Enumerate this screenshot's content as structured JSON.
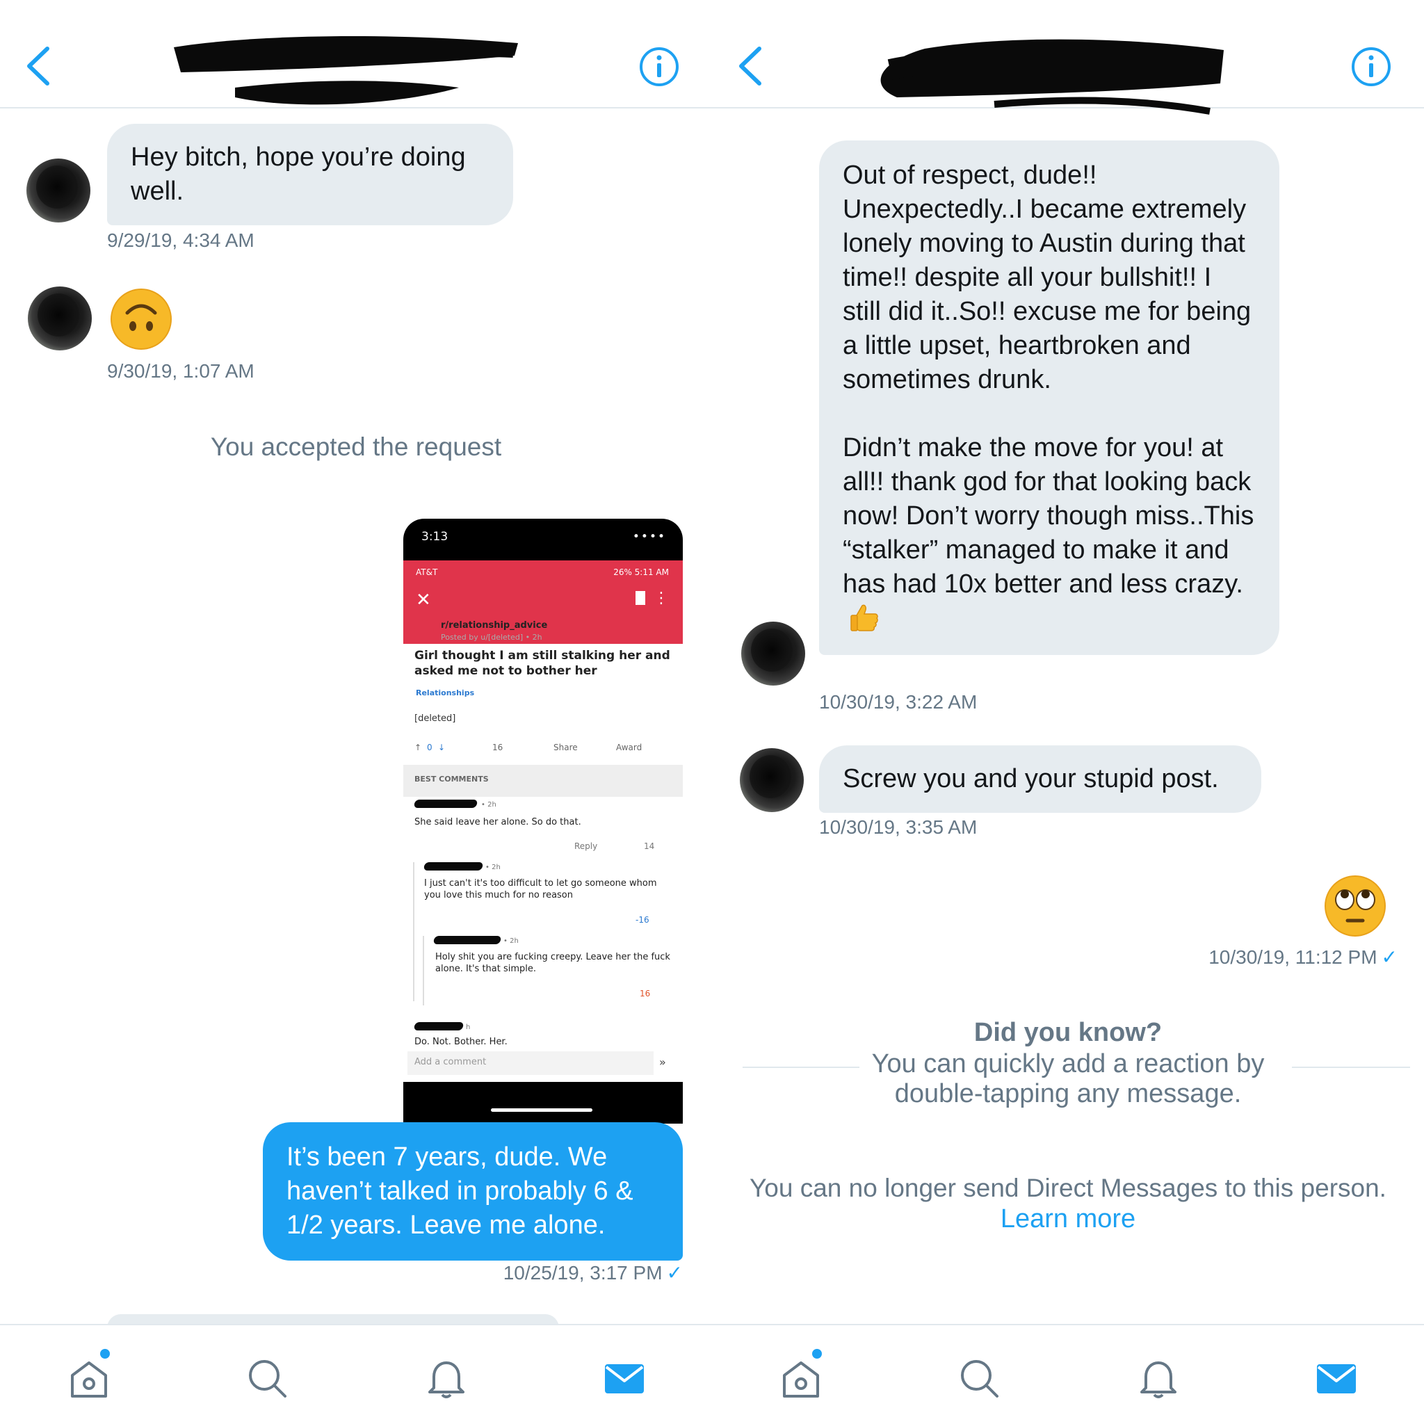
{
  "left": {
    "messages": [
      {
        "text": "Hey bitch, hope you’re doing well.",
        "time": "9/29/19, 4:34 AM"
      },
      {
        "emoji": "upside-down-face",
        "time": "9/30/19, 1:07 AM"
      }
    ],
    "system_note": "You accepted the request",
    "sent": {
      "text": "It’s been 7 years, dude. We haven’t talked in probably 6 & 1/2 years. Leave me alone.",
      "time": "10/25/19, 3:17 PM",
      "check": "✓"
    },
    "attachment": {
      "status_time": "3:13",
      "status_icons": "••••",
      "carrier": "AT&T",
      "android_status": "26% 5:11 AM",
      "close": "✕",
      "menu": "⋮",
      "subreddit": "r/relationship_advice",
      "posted_by": "Posted by u/[deleted] • 2h",
      "title": "Girl thought I am still stalking her and asked me not to bother her",
      "flair": "Relationships",
      "body": "[deleted]",
      "votes": "0",
      "comments": "16",
      "share": "Share",
      "award": "Award",
      "sort": "BEST COMMENTS",
      "comment_list": [
        {
          "age": "• 2h",
          "text": "She said leave her alone.  So do that.",
          "reply": "Reply",
          "score": "14"
        },
        {
          "age": "• 2h",
          "text": "I just can't it's too difficult to let go someone whom you love this much for no reason",
          "score": "-16"
        },
        {
          "age": "• 2h",
          "text": "Holy shit you are fucking creepy.  Leave her the fuck alone.  It's that simple.",
          "score": "16"
        },
        {
          "age": "h",
          "text": "Do. Not. Bother. Her."
        }
      ],
      "add_comment": "Add a comment",
      "expand": "»"
    }
  },
  "right": {
    "messages": [
      {
        "paragraphs": [
          "Out of respect, dude!! Unexpectedly..I became extremely lonely moving to Austin during that time!! despite all your bullshit!! I still did it..So!! excuse me for being a little upset, heartbroken and sometimes drunk.",
          "Didn’t  make the move for you! at all!! thank god for that looking back now! Don’t worry though miss..This “stalker” managed to make it and has had 10x better and less crazy."
        ],
        "emoji": "thumbs-up",
        "time": "10/30/19, 3:22 AM"
      },
      {
        "text": "Screw you and your stupid post.",
        "time": "10/30/19, 3:35 AM"
      }
    ],
    "sent": {
      "emoji": "face-with-rolling-eyes",
      "time": "10/30/19, 11:12 PM",
      "check": "✓"
    },
    "tip": {
      "title": "Did you know?",
      "body_line1": "You can quickly add a reaction by",
      "body_line2": "double-tapping any message."
    },
    "blocked": {
      "text": "You can no longer send Direct Messages to this person.",
      "link": "Learn more"
    }
  },
  "tabbar": {
    "tabs": [
      "home-icon",
      "search-icon",
      "notifications-bell-icon",
      "messages-envelope-icon"
    ]
  },
  "colors": {
    "accent": "#1da1f2",
    "bubble_in": "#e6ecf0",
    "secondary_text": "#657786",
    "reddit_red": "#e0344b"
  }
}
